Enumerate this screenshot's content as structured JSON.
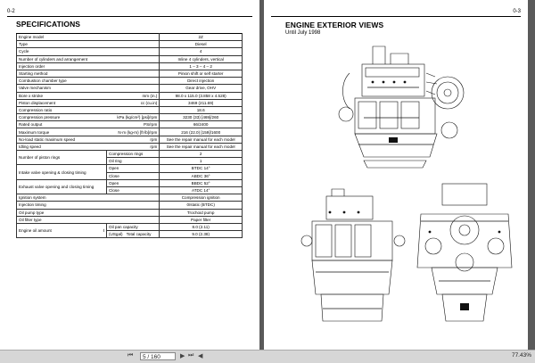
{
  "left_page": {
    "page_number": "0-2",
    "heading": "SPECIFICATIONS",
    "spec_rows": [
      {
        "label": "Engine model",
        "unit": "",
        "value": "2Z"
      },
      {
        "label": "Type",
        "unit": "",
        "value": "Diesel"
      },
      {
        "label": "Cycle",
        "unit": "",
        "value": "4"
      },
      {
        "label": "Number of cylinders and arrangement",
        "unit": "",
        "value": "Inline 4 cylinders, vertical"
      },
      {
        "label": "Injection order",
        "unit": "",
        "value": "1 – 3 – 4 – 2"
      },
      {
        "label": "Starting method",
        "unit": "",
        "value": "Pinion shift or self starter"
      },
      {
        "label": "Combustion chamber type",
        "unit": "",
        "value": "Direct injection"
      },
      {
        "label": "Valve mechanism",
        "unit": "",
        "value": "Gear drive, OHV"
      },
      {
        "label": "Bore x stroke",
        "unit": "mm (in.)",
        "value": "98.0 x 115.0 (3.858 x 4.528)"
      },
      {
        "label": "Piston displacement",
        "unit": "cc (cu.in)",
        "value": "3469 (211.69)"
      },
      {
        "label": "Compression ratio",
        "unit": "",
        "value": "18.6"
      },
      {
        "label": "Compression pressure",
        "unit": "kPa (kg/cm²) [psi]/rpm",
        "value": "3230 (33) [469]/260"
      },
      {
        "label": "Rated output",
        "unit": "PS/rpm",
        "value": "66/2400"
      },
      {
        "label": "Maximum torque",
        "unit": "N·m (kg-m) [ft·lb]/rpm",
        "value": "216 (22.0) [159]/1600"
      },
      {
        "label": "No-load static maximum speed",
        "unit": "rpm",
        "value": "See the repair manual for each model"
      },
      {
        "label": "Idling speed",
        "unit": "rpm",
        "value": "See the repair manual for each model"
      }
    ],
    "piston_rings": {
      "label": "Number of piston rings",
      "items": [
        {
          "name": "Compression rings",
          "value": "2"
        },
        {
          "name": "Oil ring",
          "value": "1"
        }
      ]
    },
    "intake_valve": {
      "label": "Intake valve opening & closing timing",
      "items": [
        {
          "name": "Open",
          "value": "BTDC 14°"
        },
        {
          "name": "Close",
          "value": "ABDC 36°"
        }
      ]
    },
    "exhaust_valve": {
      "label": "Exhaust valve opening and closing timing",
      "items": [
        {
          "name": "Open",
          "value": "BBDC 52°"
        },
        {
          "name": "Close",
          "value": "ATDC 14°"
        }
      ]
    },
    "tail_rows": [
      {
        "label": "Ignition system",
        "value": "Compression ignition"
      },
      {
        "label": "Injection timing",
        "value": "0/static (BTDC)"
      },
      {
        "label": "Oil pump type",
        "value": "Trochoid pump"
      },
      {
        "label": "Oil filter type",
        "value": "Paper filter"
      }
    ],
    "engine_oil": {
      "label": "Engine oil amount",
      "unit_top": "ℓ",
      "unit_bottom": "(USgal)",
      "items": [
        {
          "name": "Oil pan capacity",
          "value": "8.0 (2.11)"
        },
        {
          "name": "Total capacity",
          "value": "9.0 (2.38)"
        }
      ]
    }
  },
  "right_page": {
    "page_number": "0-3",
    "heading": "ENGINE EXTERIOR VIEWS",
    "subheading": "Until July 1998"
  },
  "statusbar": {
    "page_box": "5 / 160",
    "zoom": "77.43%",
    "first_icon": "first-page-icon",
    "prev_icon": "prev-page-icon",
    "next_icon": "next-page-icon",
    "last_icon": "last-page-icon"
  }
}
